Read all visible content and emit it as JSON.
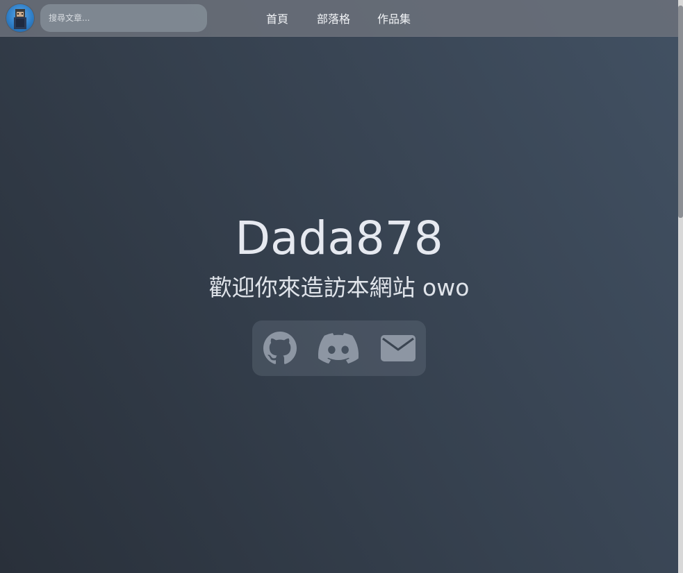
{
  "header": {
    "avatar_icon": "avatar-icon",
    "search": {
      "placeholder": "搜尋文章..."
    },
    "nav": [
      {
        "label": "首頁"
      },
      {
        "label": "部落格"
      },
      {
        "label": "作品集"
      }
    ]
  },
  "hero": {
    "title": "Dada878",
    "subtitle": "歡迎你來造訪本網站 owo"
  },
  "socials": [
    {
      "icon": "github-icon"
    },
    {
      "icon": "discord-icon"
    },
    {
      "icon": "mail-icon"
    }
  ],
  "colors": {
    "background_start": "#29303a",
    "background_end": "#425163",
    "text": "#e6e9f0",
    "icon": "#8d96a3"
  }
}
